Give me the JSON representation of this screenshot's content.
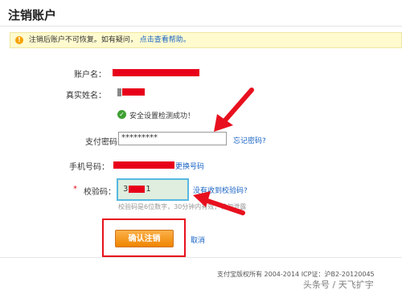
{
  "page": {
    "title": "注销账户"
  },
  "notice": {
    "text": "注销后账户不可恢复。如有疑问，",
    "link": "点击查看帮助。"
  },
  "form": {
    "account_label": "账户名：",
    "realname_label": "真实姓名：",
    "security_msg": "安全设置检测成功！",
    "pay_password_label": "支付密码",
    "pay_password_value": "*********",
    "forgot_password": "忘记密码?",
    "phone_label": "手机号码：",
    "change_phone": "更换号码",
    "required_mark": "*",
    "code_label": "校验码：",
    "code_value_prefix": "3",
    "code_value_suffix": "1",
    "no_code": "没有收到校验码?",
    "code_hint": "校验码是6位数字，30分钟内有效，请勿泄露",
    "confirm_button": "确认注销",
    "cancel_link": "取消"
  },
  "footer": {
    "copyright": "支付宝版权所有 2004-2014 ICP证：沪B2-20120045"
  },
  "watermark": {
    "text": "头条号 / 天飞扩宇"
  },
  "colors": {
    "accent": "#ef8400",
    "link": "#1a64c4",
    "highlight": "#e8101e"
  }
}
